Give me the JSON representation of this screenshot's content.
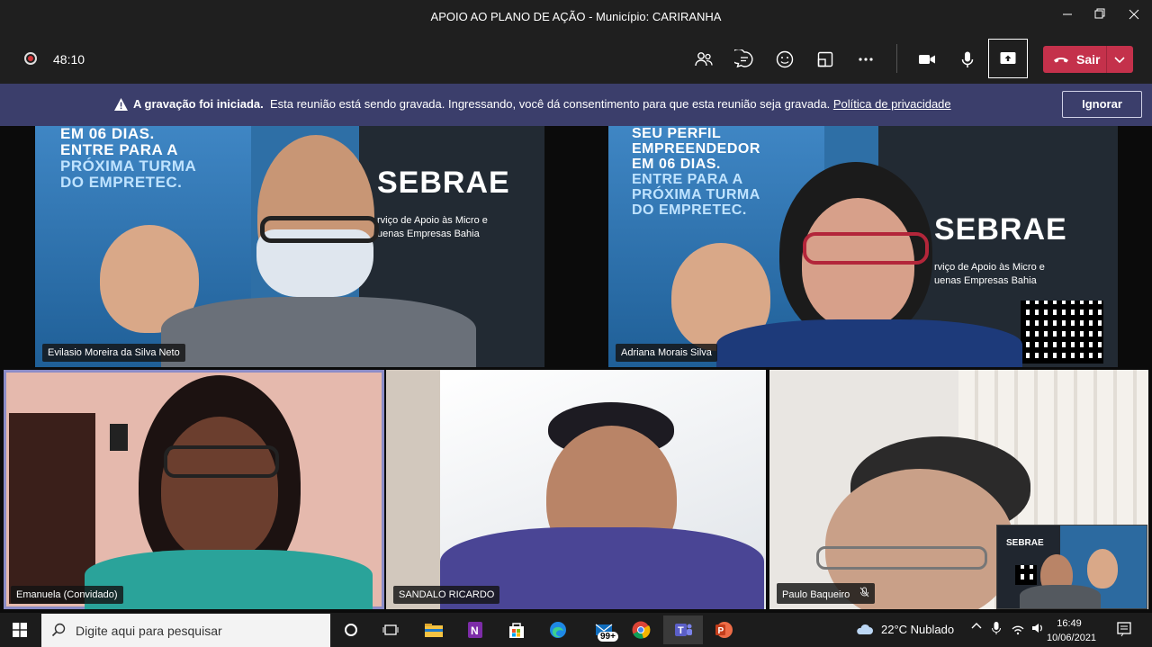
{
  "window": {
    "title": "APOIO AO PLANO DE AÇÃO - Município: CARIRANHA",
    "controls": [
      "minimize-icon",
      "maximize-icon",
      "close-icon"
    ]
  },
  "toolbar": {
    "timer": "48:10",
    "leave_label": "Sair",
    "icons": [
      "people-icon",
      "chat-icon",
      "raise-hand-icon",
      "rooms-icon",
      "more-icon",
      "camera-icon",
      "mic-icon",
      "share-screen-icon"
    ]
  },
  "banner": {
    "bold": "A gravação foi iniciada.",
    "text": "Esta reunião está sendo gravada. Ingressando, você dá consentimento para que esta reunião seja gravada.",
    "link": "Política de privacidade",
    "ignore_label": "Ignorar"
  },
  "participants": [
    {
      "name": "Evilasio Moreira da Silva Neto",
      "muted": false,
      "active": false
    },
    {
      "name": "Adriana Morais Silva",
      "muted": false,
      "active": false
    },
    {
      "name": "Emanuela (Convidado)",
      "muted": false,
      "active": true
    },
    {
      "name": "SANDALO RICARDO",
      "muted": false,
      "active": true
    },
    {
      "name": "Paulo Baqueiro",
      "muted": true,
      "active": false
    }
  ],
  "backgrounds": {
    "left_banner": [
      "EM 06 DIAS.",
      "ENTRE PARA A",
      "PRÓXIMA TURMA",
      "DO EMPRETEC."
    ],
    "right_banner": [
      "SEU PERFIL",
      "EMPREENDEDOR",
      "EM 06 DIAS.",
      "ENTRE PARA A",
      "PRÓXIMA TURMA",
      "DO EMPRETEC."
    ],
    "logo": "SEBRAE",
    "logo_sub": [
      "rviço de Apoio às Micro e",
      "uenas Empresas Bahia"
    ]
  },
  "taskbar": {
    "search_placeholder": "Digite aqui para pesquisar",
    "mail_badge": "99+",
    "weather": "22°C  Nublado",
    "time": "16:49",
    "date": "10/06/2021"
  }
}
